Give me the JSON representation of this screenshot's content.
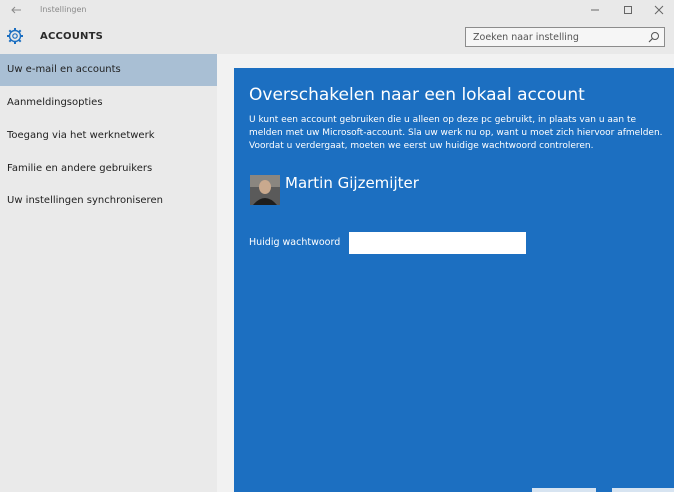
{
  "window": {
    "title": "Instellingen"
  },
  "header": {
    "heading": "ACCOUNTS",
    "search_placeholder": "Zoeken naar instelling"
  },
  "sidebar": {
    "items": [
      {
        "label": "Uw e-mail en accounts",
        "active": true
      },
      {
        "label": "Aanmeldingsopties",
        "active": false
      },
      {
        "label": "Toegang via het werknetwerk",
        "active": false
      },
      {
        "label": "Familie en andere gebruikers",
        "active": false
      },
      {
        "label": "Uw instellingen synchroniseren",
        "active": false
      }
    ]
  },
  "dialog": {
    "title": "Overschakelen naar een lokaal account",
    "description_lines": [
      "U kunt een account gebruiken die u alleen op deze pc gebruikt, in plaats van u aan te",
      "melden met uw Microsoft-account. Sla uw werk nu op, want u moet zich hiervoor afmelden.",
      "Voordat u verdergaat, moeten we eerst uw huidige wachtwoord controleren."
    ],
    "user_name": "Martin Gijzemijter",
    "password_label": "Huidig wachtwoord",
    "password_value": ""
  },
  "colors": {
    "dialog_bg": "#1c6fc1",
    "selected_nav": "#a9bfd4",
    "chrome_bg": "#e9e9e9"
  }
}
